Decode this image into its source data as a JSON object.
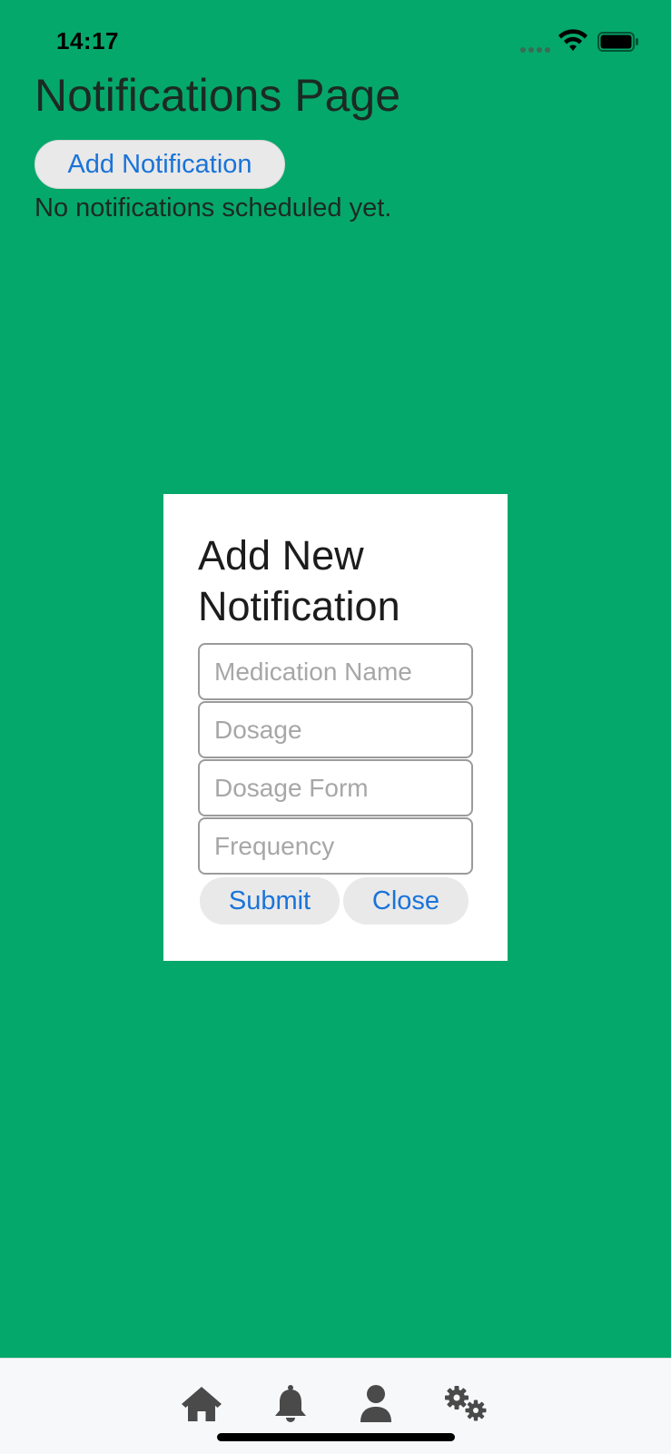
{
  "status_bar": {
    "time": "14:17"
  },
  "page": {
    "title": "Notifications Page",
    "add_button_label": "Add Notification",
    "empty_message": "No notifications scheduled yet."
  },
  "modal": {
    "title": "Add New Notification",
    "fields": [
      {
        "placeholder": "Medication Name",
        "value": ""
      },
      {
        "placeholder": "Dosage",
        "value": ""
      },
      {
        "placeholder": "Dosage Form",
        "value": ""
      },
      {
        "placeholder": "Frequency",
        "value": ""
      }
    ],
    "submit_label": "Submit",
    "close_label": "Close"
  },
  "tab_bar": {
    "items": [
      {
        "icon": "home-icon"
      },
      {
        "icon": "bell-icon"
      },
      {
        "icon": "user-icon"
      },
      {
        "icon": "gears-icon"
      }
    ]
  },
  "colors": {
    "background": "#05a86b",
    "accent": "#1a73d9",
    "button_bg": "#e9e9e9",
    "tab_icon": "#4a4a4a"
  }
}
